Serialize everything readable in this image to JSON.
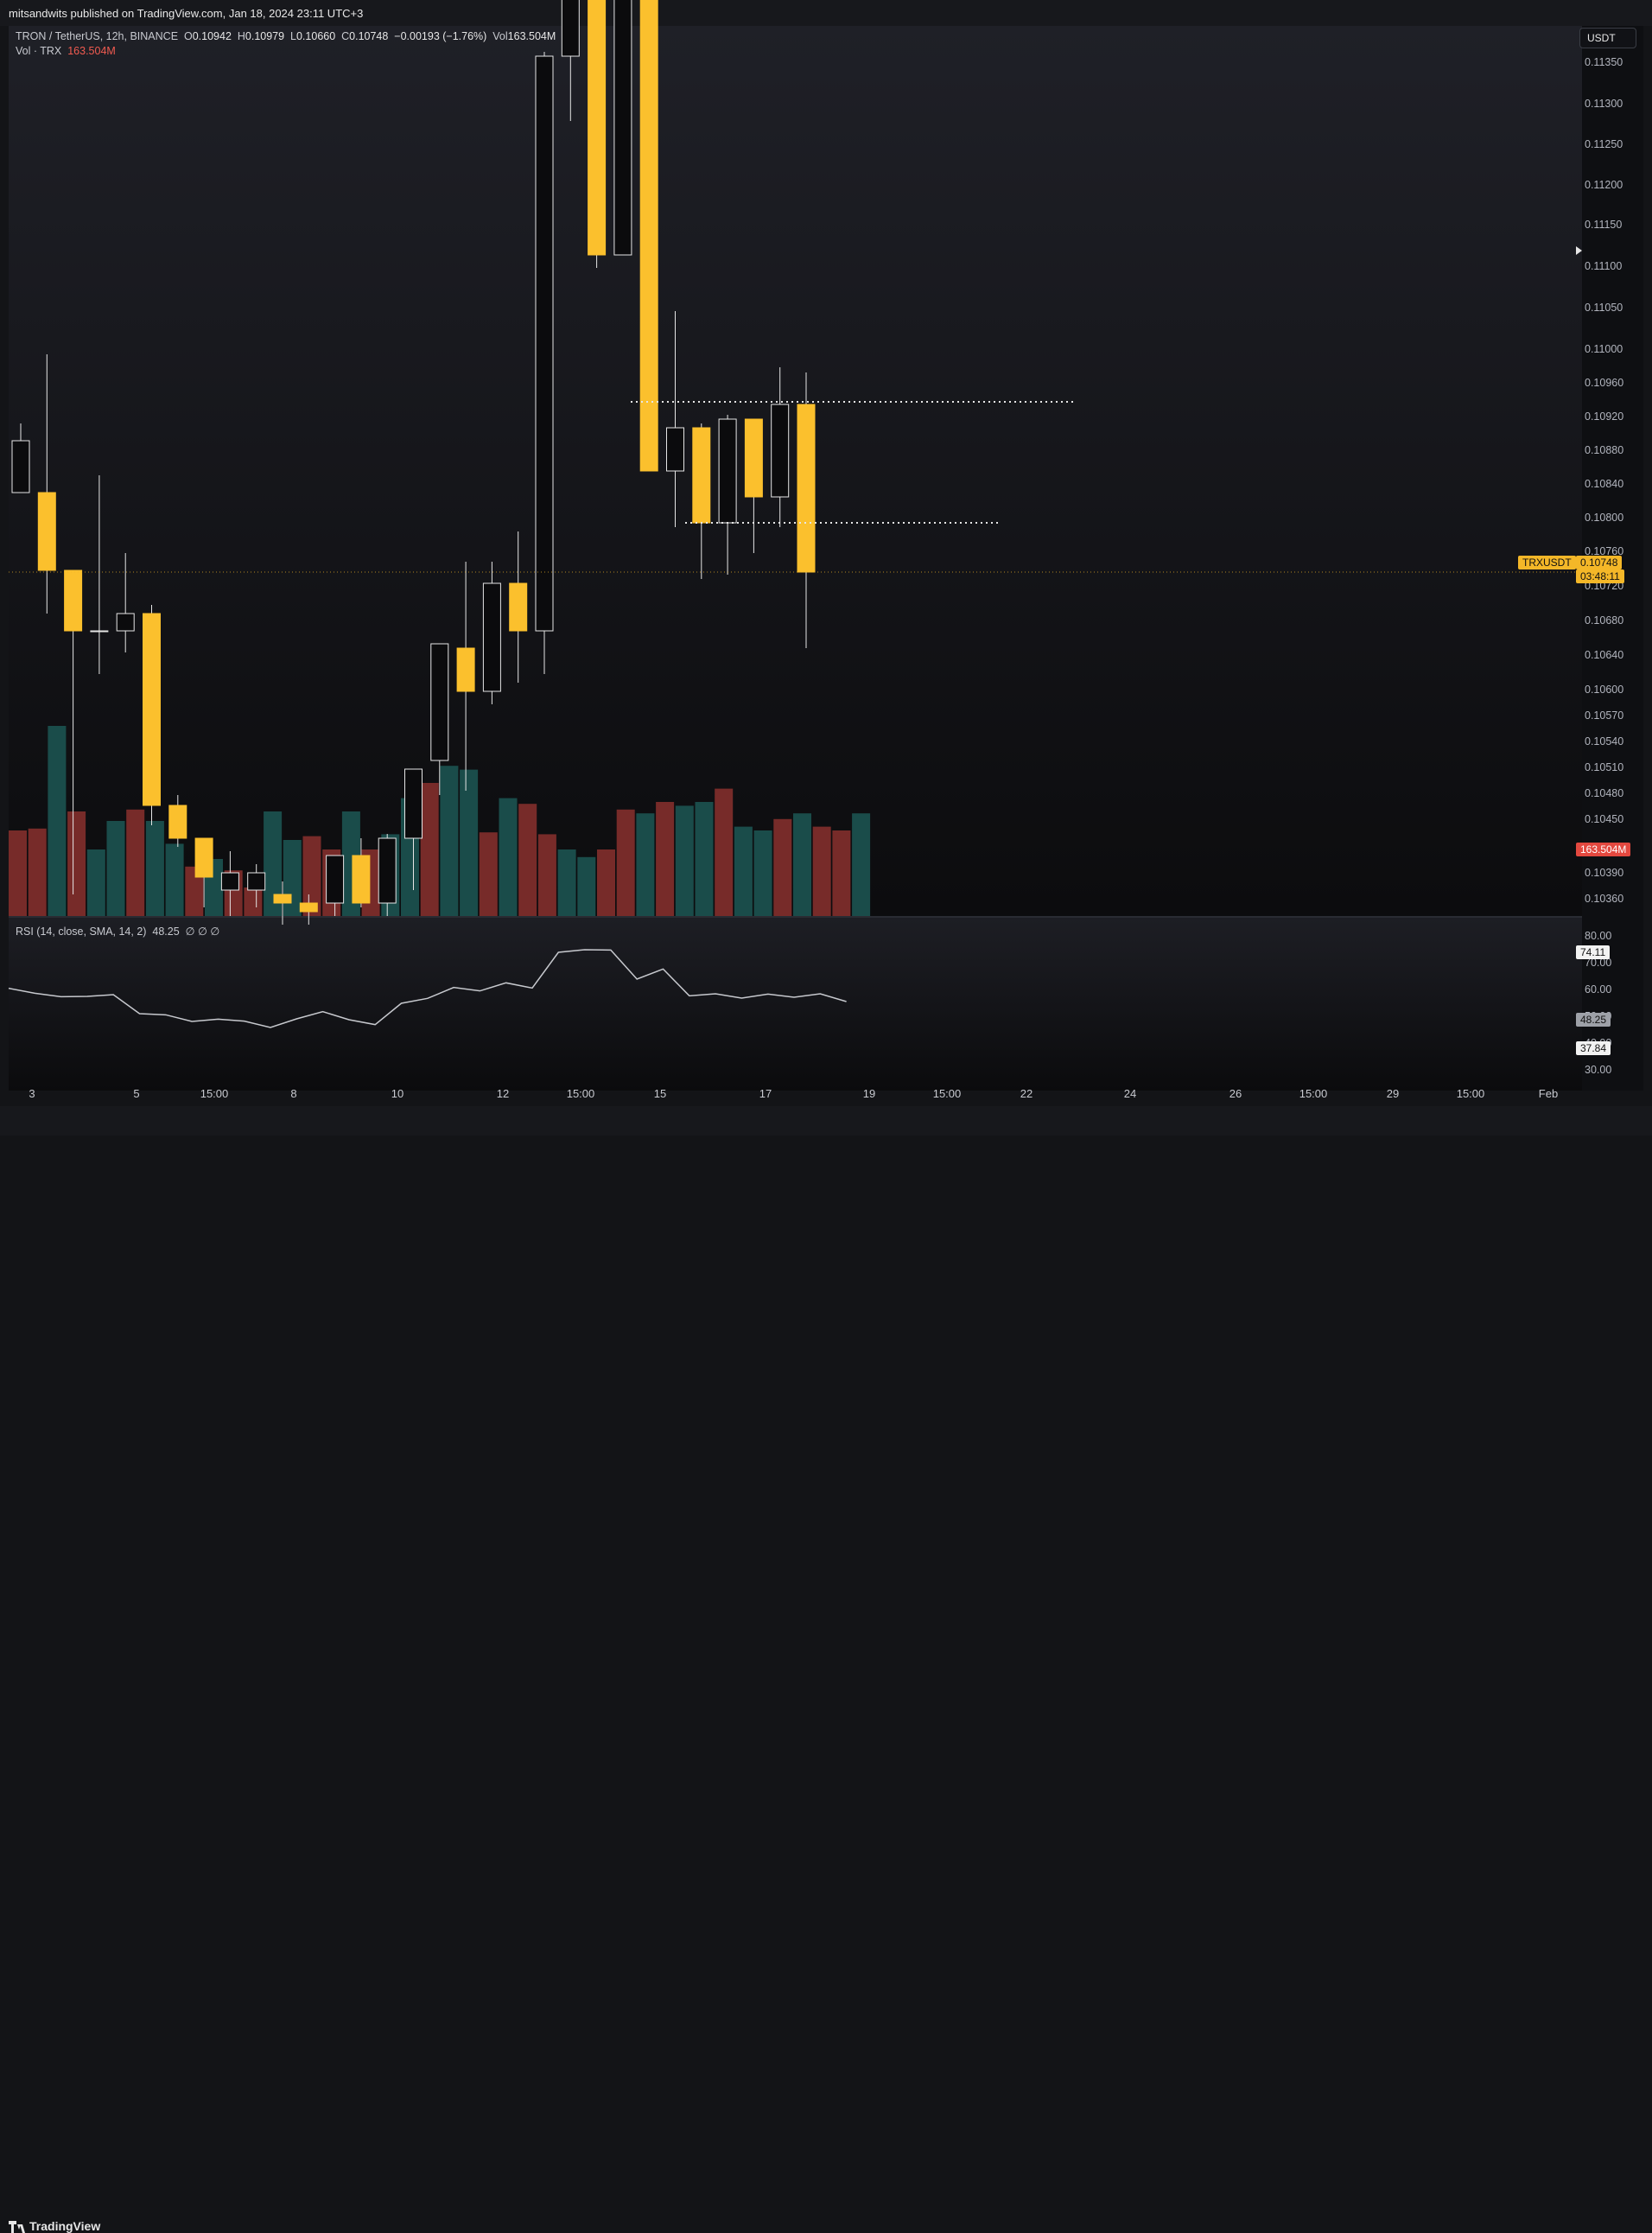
{
  "header": {
    "published": "mitsandwits published on TradingView.com, Jan 18, 2024 23:11 UTC+3"
  },
  "legend": {
    "symbol": "TRON / TetherUS, 12h, BINANCE",
    "o_label": "O",
    "o_value": "0.10942",
    "h_label": "H",
    "h_value": "0.10979",
    "l_label": "L",
    "l_value": "0.10660",
    "c_label": "C",
    "c_value": "0.10748",
    "change": "−0.00193 (−1.76%)",
    "vol_label": "Vol",
    "vol_value": "163.504M"
  },
  "vol_legend": {
    "label": "Vol · TRX",
    "value": "163.504M"
  },
  "rsi_legend": {
    "label": "RSI (14, close, SMA, 14, 2)",
    "value": "48.25",
    "flags": "∅ ∅ ∅"
  },
  "currency": "USDT",
  "price_axis": [
    "0.11350",
    "0.11300",
    "0.11250",
    "0.11200",
    "0.11150",
    "0.11100",
    "0.11050",
    "0.11000",
    "0.10960",
    "0.10920",
    "0.10880",
    "0.10840",
    "0.10800",
    "0.10760",
    "0.10720",
    "0.10680",
    "0.10640",
    "0.10600",
    "0.10570",
    "0.10540",
    "0.10510",
    "0.10480",
    "0.10450",
    "0.10390",
    "0.10360"
  ],
  "rsi_axis": [
    "80.00",
    "70.00",
    "60.00",
    "50.00",
    "40.00",
    "30.00"
  ],
  "time_axis": [
    "3",
    "5",
    "15:00",
    "8",
    "10",
    "12",
    "15:00",
    "15",
    "17",
    "19",
    "15:00",
    "22",
    "24",
    "26",
    "15:00",
    "29",
    "15:00",
    "Feb"
  ],
  "tags": {
    "symbol_tag": "TRXUSDT",
    "last_price": "0.10748",
    "countdown": "03:48:11",
    "volume_tag": "163.504M",
    "rsi_upper": "74.11",
    "rsi_current": "48.25",
    "rsi_lower": "37.84"
  },
  "colors": {
    "up": "#0b0b0d",
    "down": "#fbc02d",
    "vol_up": "#1a4c4a",
    "vol_down": "#772b29",
    "accent_red": "#f15b50"
  },
  "footer": {
    "brand": "TradingView"
  },
  "chart_data": {
    "type": "candlestick",
    "title": "TRON / TetherUS, 12h, BINANCE",
    "ylim": [
      0.1035,
      0.1138
    ],
    "candles": [
      {
        "o": 0.1084,
        "h": 0.1092,
        "l": 0.1084,
        "c": 0.109
      },
      {
        "o": 0.1084,
        "h": 0.11,
        "l": 0.107,
        "c": 0.1075
      },
      {
        "o": 0.1075,
        "h": 0.1072,
        "l": 0.10375,
        "c": 0.1068
      },
      {
        "o": 0.1068,
        "h": 0.1086,
        "l": 0.1063,
        "c": 0.1068
      },
      {
        "o": 0.1068,
        "h": 0.1077,
        "l": 0.10655,
        "c": 0.107
      },
      {
        "o": 0.107,
        "h": 0.1071,
        "l": 0.10455,
        "c": 0.10478
      },
      {
        "o": 0.10478,
        "h": 0.1049,
        "l": 0.1043,
        "c": 0.1044
      },
      {
        "o": 0.1044,
        "h": 0.1043,
        "l": 0.1036,
        "c": 0.10395
      },
      {
        "o": 0.1038,
        "h": 0.10425,
        "l": 0.1035,
        "c": 0.104
      },
      {
        "o": 0.1038,
        "h": 0.1041,
        "l": 0.1036,
        "c": 0.104
      },
      {
        "o": 0.10375,
        "h": 0.1039,
        "l": 0.1034,
        "c": 0.10365
      },
      {
        "o": 0.10365,
        "h": 0.10375,
        "l": 0.1034,
        "c": 0.10355
      },
      {
        "o": 0.10365,
        "h": 0.1042,
        "l": 0.1035,
        "c": 0.1042
      },
      {
        "o": 0.1042,
        "h": 0.1044,
        "l": 0.1036,
        "c": 0.10365
      },
      {
        "o": 0.10365,
        "h": 0.10445,
        "l": 0.1035,
        "c": 0.1044
      },
      {
        "o": 0.1044,
        "h": 0.1051,
        "l": 0.1038,
        "c": 0.1052
      },
      {
        "o": 0.1053,
        "h": 0.10565,
        "l": 0.1049,
        "c": 0.10665
      },
      {
        "o": 0.1066,
        "h": 0.1076,
        "l": 0.10495,
        "c": 0.1061
      },
      {
        "o": 0.1061,
        "h": 0.1076,
        "l": 0.10595,
        "c": 0.10735
      },
      {
        "o": 0.10735,
        "h": 0.10795,
        "l": 0.1062,
        "c": 0.1068
      },
      {
        "o": 0.1068,
        "h": 0.1135,
        "l": 0.1063,
        "c": 0.11345
      },
      {
        "o": 0.11345,
        "h": 0.116,
        "l": 0.1127,
        "c": 0.116
      },
      {
        "o": 0.116,
        "h": 0.116,
        "l": 0.111,
        "c": 0.11115
      },
      {
        "o": 0.11115,
        "h": 0.116,
        "l": 0.11115,
        "c": 0.116
      },
      {
        "o": 0.116,
        "h": 0.116,
        "l": 0.10865,
        "c": 0.10865
      },
      {
        "o": 0.10865,
        "h": 0.1105,
        "l": 0.108,
        "c": 0.10915
      },
      {
        "o": 0.10915,
        "h": 0.1092,
        "l": 0.1074,
        "c": 0.10805
      },
      {
        "o": 0.10805,
        "h": 0.1093,
        "l": 0.10745,
        "c": 0.10925
      },
      {
        "o": 0.10925,
        "h": 0.10925,
        "l": 0.1077,
        "c": 0.10835
      },
      {
        "o": 0.10835,
        "h": 0.10985,
        "l": 0.108,
        "c": 0.10942
      },
      {
        "o": 0.10942,
        "h": 0.10979,
        "l": 0.1066,
        "c": 0.10748
      }
    ],
    "volume_relative": [
      0.45,
      0.46,
      1.0,
      0.55,
      0.35,
      0.5,
      0.56,
      0.5,
      0.38,
      0.26,
      0.3,
      0.24,
      0.15,
      0.55,
      0.4,
      0.42,
      0.35,
      0.55,
      0.35,
      0.43,
      0.62,
      0.7,
      0.79,
      0.77,
      0.44,
      0.62,
      0.59,
      0.43,
      0.35,
      0.31,
      0.35,
      0.56,
      0.54,
      0.6,
      0.58,
      0.6,
      0.67,
      0.47,
      0.45,
      0.51,
      0.54,
      0.47,
      0.45,
      0.54
    ],
    "rsi": [
      60.5,
      58.8,
      57.6,
      57.7,
      58.3,
      51.7,
      51.3,
      49.0,
      49.8,
      49.1,
      46.9,
      49.9,
      52.4,
      49.6,
      47.9,
      55.3,
      57.0,
      60.8,
      59.6,
      62.4,
      60.6,
      73.0,
      73.9,
      73.8,
      63.7,
      67.2,
      57.9,
      58.6,
      57.1,
      58.5,
      57.4,
      58.6,
      55.9
    ],
    "levels": [
      0.10945,
      0.10805
    ]
  }
}
